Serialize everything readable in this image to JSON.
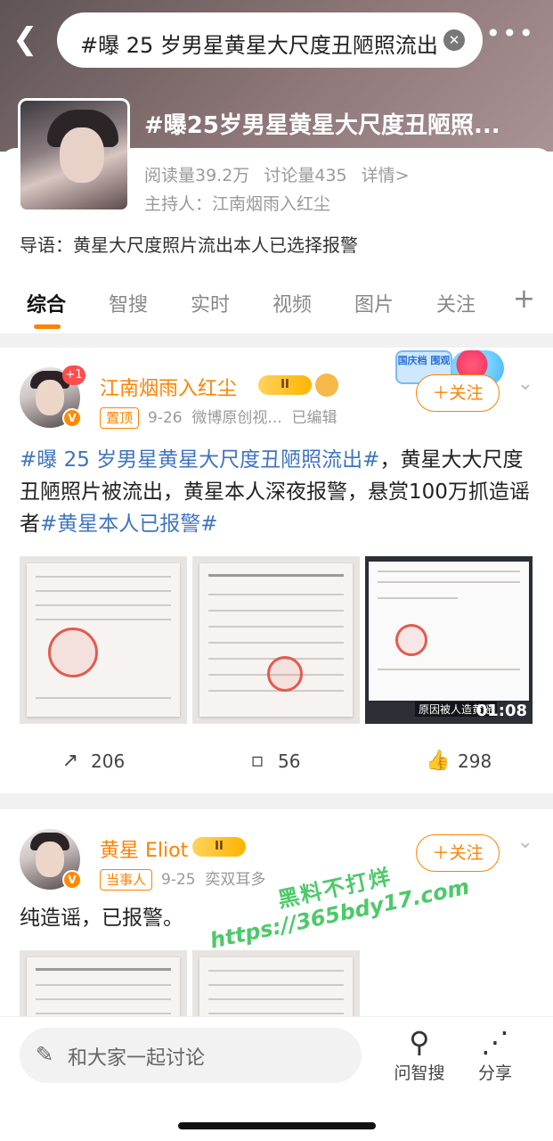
{
  "search": {
    "query": "#曝 25 岁男星黄星大尺度丑陋照流出"
  },
  "topic": {
    "title": "#曝25岁男星黄星大尺度丑陋照...",
    "reads": "阅读量39.2万",
    "discussions": "讨论量435",
    "details": "详情>",
    "host_label": "主持人：",
    "host_name": "江南烟雨入红尘",
    "lead": "导语：黄星大尺度照片流出本人已选择报警"
  },
  "tabs": [
    {
      "label": "综合",
      "active": true
    },
    {
      "label": "智搜"
    },
    {
      "label": "实时"
    },
    {
      "label": "视频"
    },
    {
      "label": "图片"
    },
    {
      "label": "关注"
    }
  ],
  "posts": [
    {
      "author": "江南烟雨入红尘",
      "vip_level": "II",
      "plus_badge": "+1",
      "tag": "置顶",
      "date": "9-26",
      "source": "微博原创视...",
      "edited": "已编辑",
      "follow": "＋关注",
      "promo_text": "国庆档 围观",
      "text_hashtag1": "#曝 25 岁男星黄星大尺度丑陋照流出#",
      "text_body": "，黄星大大尺度丑陋照片被流出，黄星本人深夜报警，悬赏100万抓造谣者",
      "text_hashtag2": "#黄星本人已报警#",
      "video_caption": "原因被人造黄谣",
      "video_duration": "01:08",
      "reposts": "206",
      "comments": "56",
      "likes": "298"
    },
    {
      "author": "黄星 Eliot",
      "vip_level": "II",
      "tag": "当事人",
      "date": "9-25",
      "source": "奕双耳多",
      "follow": "＋关注",
      "text": "纯造谣，已报警。"
    }
  ],
  "watermark": {
    "line1": "黑料不打烊",
    "line2": "https://365bdy17.com"
  },
  "bottom": {
    "comment_placeholder": "和大家一起讨论",
    "ask_label": "问智搜",
    "share_label": "分享"
  },
  "colors": {
    "accent": "#ff8200",
    "hashtag": "#3f74c0",
    "watermark": "#4dc96a"
  }
}
